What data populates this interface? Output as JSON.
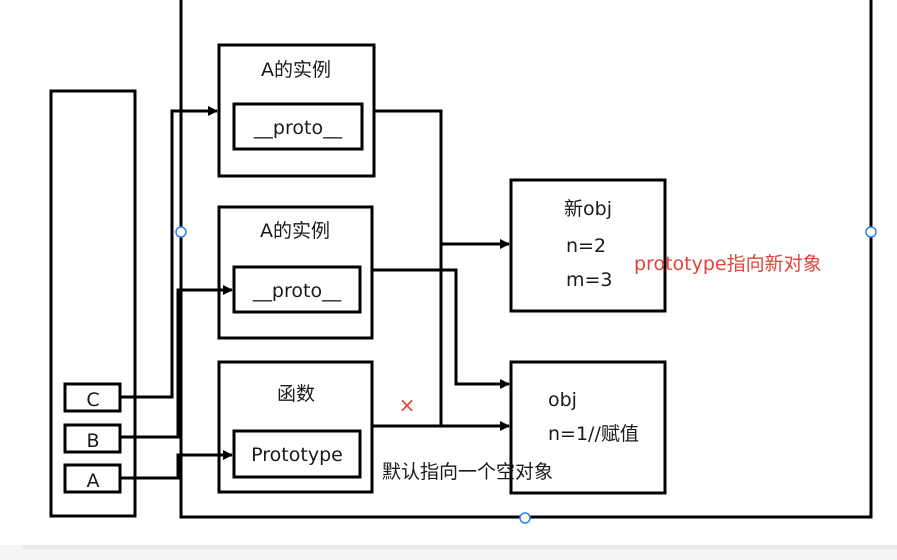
{
  "instance_top": {
    "title": "A的实例",
    "proto_label": "__proto__"
  },
  "instance_mid": {
    "title": "A的实例",
    "proto_label": "__proto__"
  },
  "func_box": {
    "title": "函数",
    "prototype_label": "Prototype"
  },
  "new_obj": {
    "title": "新obj",
    "line1": "n=2",
    "line2": "m=3"
  },
  "obj": {
    "title": "obj",
    "line1": "n=1//赋值"
  },
  "annotation_red": "prototype指向新对象",
  "annotation_default": "默认指向一个空对象",
  "cross_mark": "×",
  "left_column": {
    "items": [
      "C",
      "B",
      "A"
    ]
  },
  "colors": {
    "stroke": "#000000",
    "annotation": "#e0443b",
    "handle": "#2d7ff9"
  }
}
